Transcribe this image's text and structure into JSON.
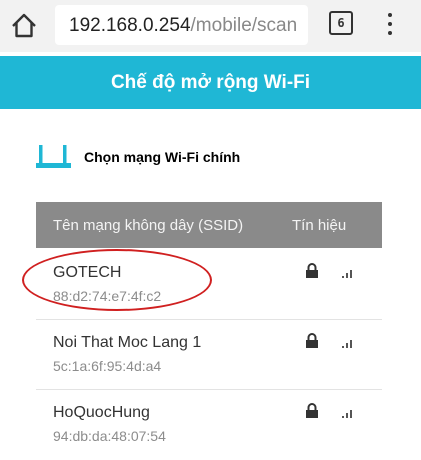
{
  "browser": {
    "url_host": "192.168.0.254",
    "url_path": "/mobile/scan",
    "tab_count": "6",
    "icons": [
      "home-icon",
      "tabs-icon",
      "overflow-menu-icon"
    ]
  },
  "page": {
    "title": "Chế độ mở rộng Wi-Fi",
    "accent_color": "#1fb7d5"
  },
  "section": {
    "title": "Chọn mạng Wi-Fi chính",
    "icon": "router-icon"
  },
  "table": {
    "headers": {
      "ssid": "Tên mạng không dây (SSID)",
      "signal": "Tín hiệu"
    },
    "rows": [
      {
        "ssid": "GOTECH",
        "mac": "88:d2:74:e7:4f:c2",
        "secured": true,
        "highlighted": true
      },
      {
        "ssid": "Noi That Moc Lang 1",
        "mac": "5c:1a:6f:95:4d:a4",
        "secured": true,
        "highlighted": false
      },
      {
        "ssid": "HoQuocHung",
        "mac": "94:db:da:48:07:54",
        "secured": true,
        "highlighted": false
      }
    ]
  },
  "annotation_color": "#d02020"
}
